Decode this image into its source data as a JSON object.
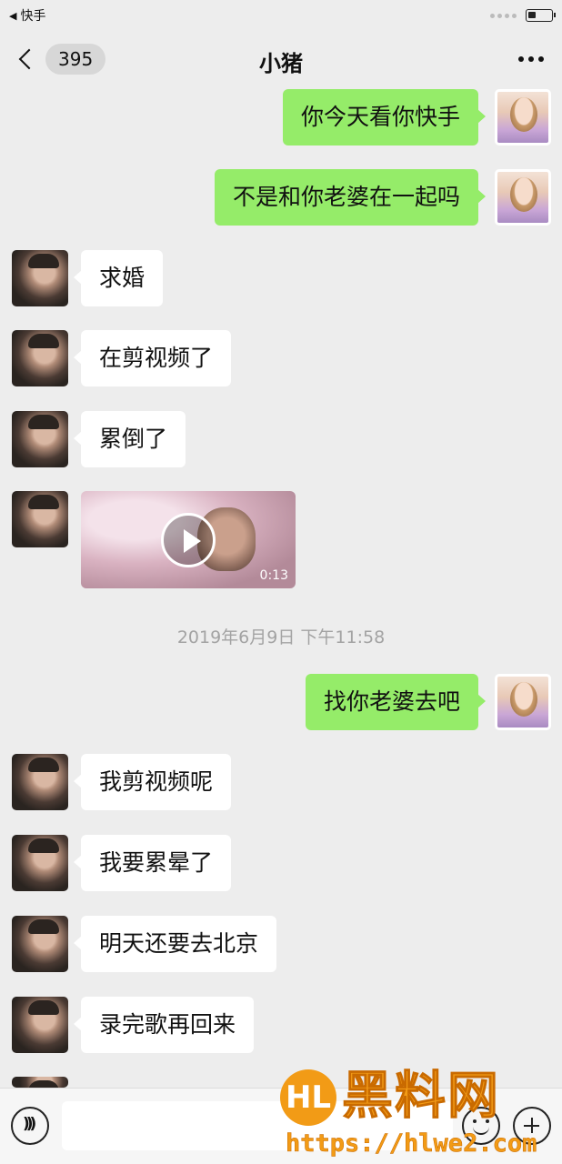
{
  "status_bar": {
    "back_app": "快手"
  },
  "nav": {
    "badge": "395",
    "title": "小猪"
  },
  "messages": [
    {
      "side": "out",
      "text": "你今天看你快手"
    },
    {
      "side": "out",
      "text": "不是和你老婆在一起吗"
    },
    {
      "side": "in",
      "text": "求婚"
    },
    {
      "side": "in",
      "text": "在剪视频了"
    },
    {
      "side": "in",
      "text": "累倒了"
    },
    {
      "side": "in",
      "type": "video",
      "duration": "0:13"
    },
    {
      "side": "out",
      "text": "找你老婆去吧"
    },
    {
      "side": "in",
      "text": "我剪视频呢"
    },
    {
      "side": "in",
      "text": "我要累晕了"
    },
    {
      "side": "in",
      "text": "明天还要去北京"
    },
    {
      "side": "in",
      "text": "录完歌再回来"
    }
  ],
  "timestamp": "2019年6月9日 下午11:58",
  "watermark": {
    "logo": "HL",
    "title": "黑料网",
    "url": "https://hlwe2.com"
  },
  "colors": {
    "out_bubble": "#95ec69",
    "in_bubble": "#ffffff",
    "background": "#ededed"
  }
}
